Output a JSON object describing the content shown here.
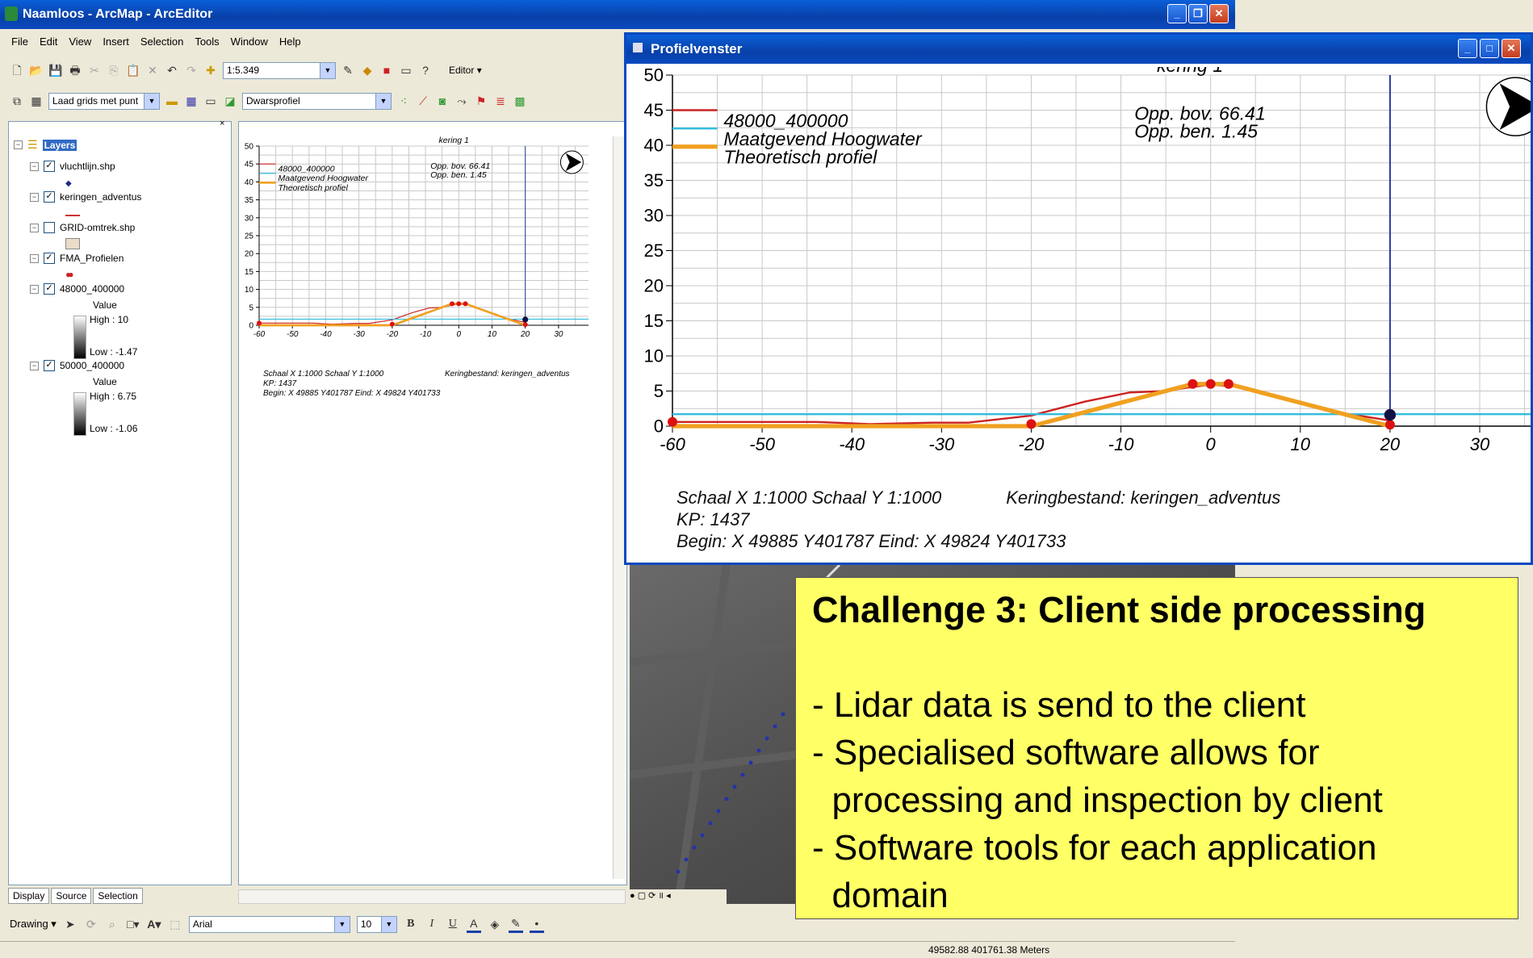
{
  "app": {
    "title": "Naamloos - ArcMap - ArcEditor",
    "menu": [
      "File",
      "Edit",
      "View",
      "Insert",
      "Selection",
      "Tools",
      "Window",
      "Help"
    ],
    "scale_value": "1:5.349",
    "editor_label": "Editor",
    "grid_combo": "Laad grids met punt",
    "profile_combo": "Dwarsprofiel",
    "font_combo": "Arial",
    "fontsize_combo": "10",
    "drawing_label": "Drawing",
    "status_coords": "49582.88  401761.38 Meters"
  },
  "toc": {
    "root": "Layers",
    "layers": [
      {
        "name": "vluchtlijn.shp",
        "checked": true
      },
      {
        "name": "keringen_adventus",
        "checked": true
      },
      {
        "name": "GRID-omtrek.shp",
        "checked": false
      },
      {
        "name": "FMA_Profielen",
        "checked": true
      },
      {
        "name": "48000_400000",
        "checked": true,
        "value_label": "Value",
        "high": "High : 10",
        "low": "Low : -1.47"
      },
      {
        "name": "50000_400000",
        "checked": true,
        "value_label": "Value",
        "high": "High : 6.75",
        "low": "Low : -1.06"
      }
    ],
    "tabs": [
      "Display",
      "Source",
      "Selection"
    ]
  },
  "profiel": {
    "window_title": "Profielvenster",
    "info_line1": "Schaal X 1:1000 Schaal Y 1:1000",
    "info_bestand": "Keringbestand: keringen_adventus",
    "info_kp": "KP: 1437",
    "info_begin": "Begin: X 49885 Y401787  Eind: X 49824 Y401733"
  },
  "chart_data": {
    "type": "line",
    "title": "kering 1",
    "annotations": [
      "Opp. bov. 66.41",
      "Opp. ben. 1.45"
    ],
    "xlim": [
      -60,
      39
    ],
    "ylim": [
      0,
      50
    ],
    "xticks": [
      -60,
      -50,
      -40,
      -30,
      -20,
      -10,
      0,
      10,
      20,
      30
    ],
    "yticks": [
      0,
      5,
      10,
      15,
      20,
      25,
      30,
      35,
      40,
      45,
      50
    ],
    "grid": true,
    "legend_position": "top-left",
    "series": [
      {
        "name": "48000_400000",
        "color": "#cc2222",
        "x": [
          -60,
          -44,
          -38,
          -31,
          -27,
          -20,
          -14,
          -9,
          -5,
          -2,
          0,
          3,
          8,
          14,
          20
        ],
        "y": [
          0.6,
          0.6,
          0.3,
          0.5,
          0.5,
          1.5,
          3.5,
          4.8,
          5.0,
          5.6,
          5.9,
          5.6,
          4.0,
          2.0,
          0.8
        ]
      },
      {
        "name": "Maatgevend Hoogwater",
        "color": "#33bbdd",
        "x": [
          -60,
          39
        ],
        "y": [
          1.7,
          1.7
        ]
      },
      {
        "name": "Theoretisch profiel",
        "color": "#f0a020",
        "x": [
          -60,
          -20,
          -2,
          2,
          20
        ],
        "y": [
          0,
          0,
          6,
          6,
          0
        ]
      }
    ],
    "points": {
      "x": [
        -60,
        -20,
        -2,
        0,
        2,
        20,
        20
      ],
      "y": [
        0.6,
        0.3,
        6.0,
        6.0,
        6.0,
        0.2,
        1.6
      ]
    },
    "vline_x": 20
  },
  "challenge": {
    "title": "Challenge 3: Client side processing",
    "lines": [
      "- Lidar data is send to the client",
      "- Specialised software allows for",
      "  processing and inspection by client",
      "- Software tools for each application",
      "  domain"
    ]
  }
}
